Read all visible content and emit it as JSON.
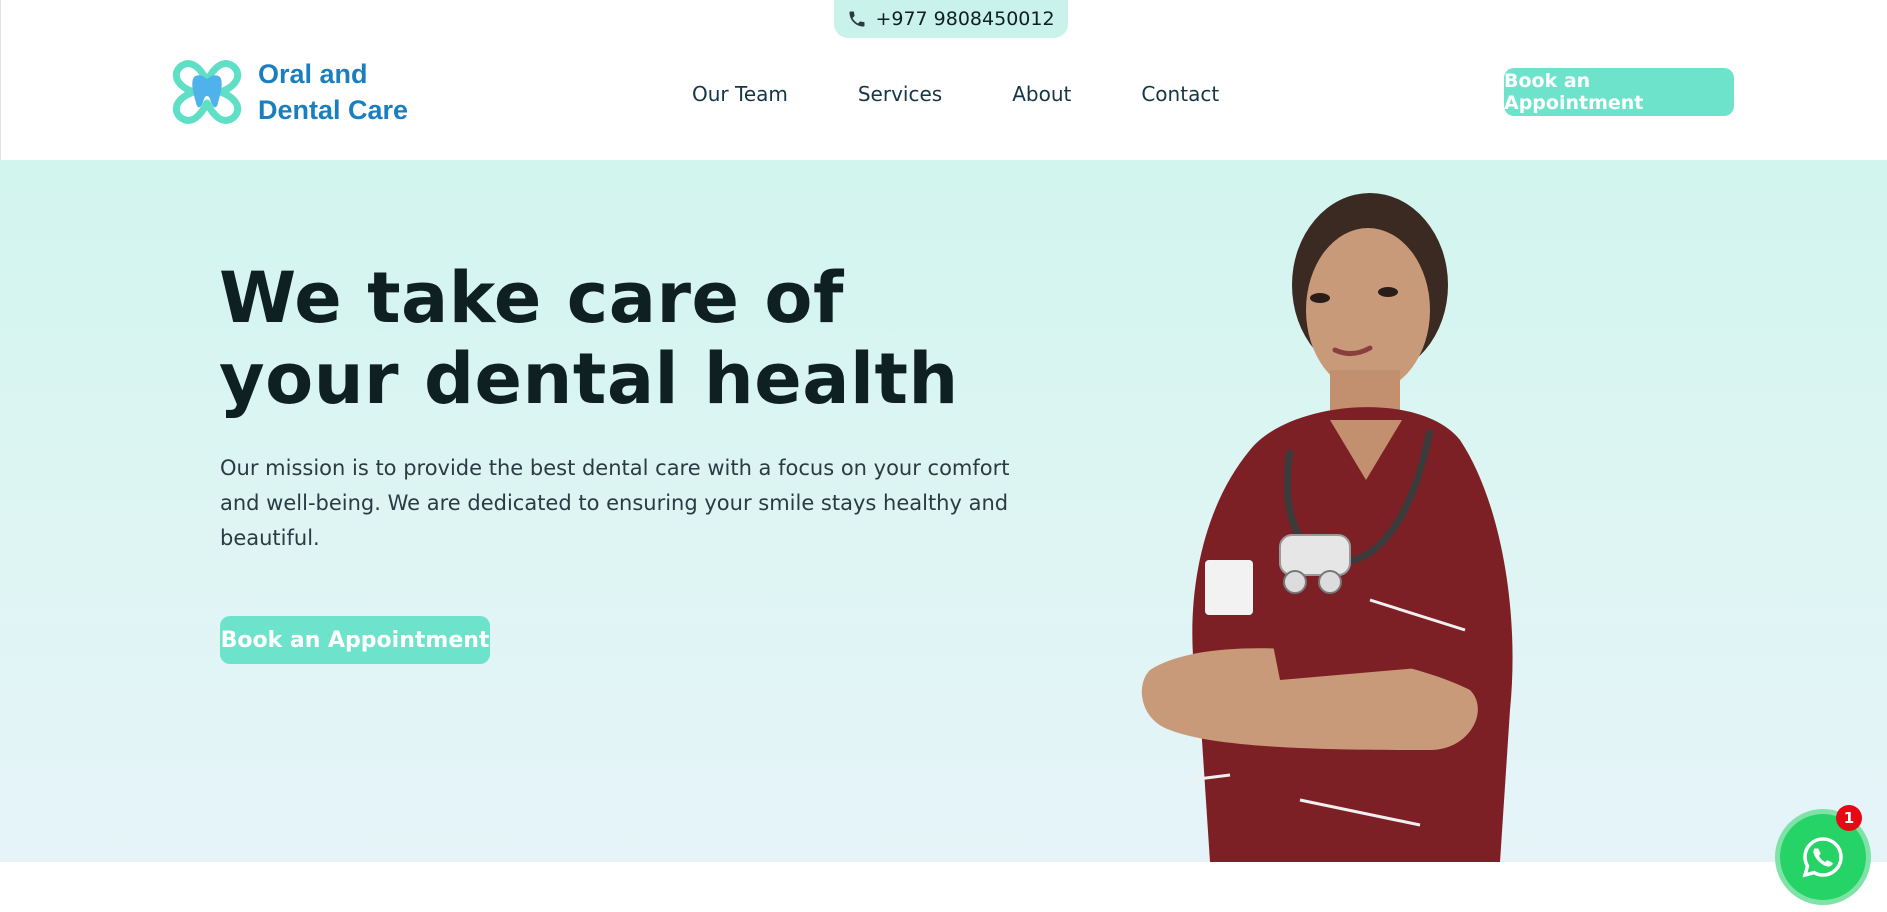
{
  "topbar": {
    "phone": "+977 9808450012",
    "phone_icon": "phone-icon"
  },
  "header": {
    "logo_line1": "Oral and",
    "logo_line2": "Dental Care",
    "nav": [
      {
        "label": "Our Team"
      },
      {
        "label": "Services"
      },
      {
        "label": "About"
      },
      {
        "label": "Contact"
      }
    ],
    "cta_label": "Book an Appointment"
  },
  "hero": {
    "title_line1": "We take care of",
    "title_line2": "your dental health",
    "description": "Our mission is to provide the best dental care with a focus on your comfort and well-being. We are dedicated to ensuring your smile stays healthy and beautiful.",
    "cta_label": "Book an Appointment"
  },
  "chat_widget": {
    "icon": "whatsapp-icon",
    "badge_count": "1"
  },
  "colors": {
    "accent": "#6ee3cb",
    "brand_text": "#1a7fbf",
    "heading": "#0f2022",
    "whatsapp": "#25d366",
    "badge": "#e50914"
  }
}
